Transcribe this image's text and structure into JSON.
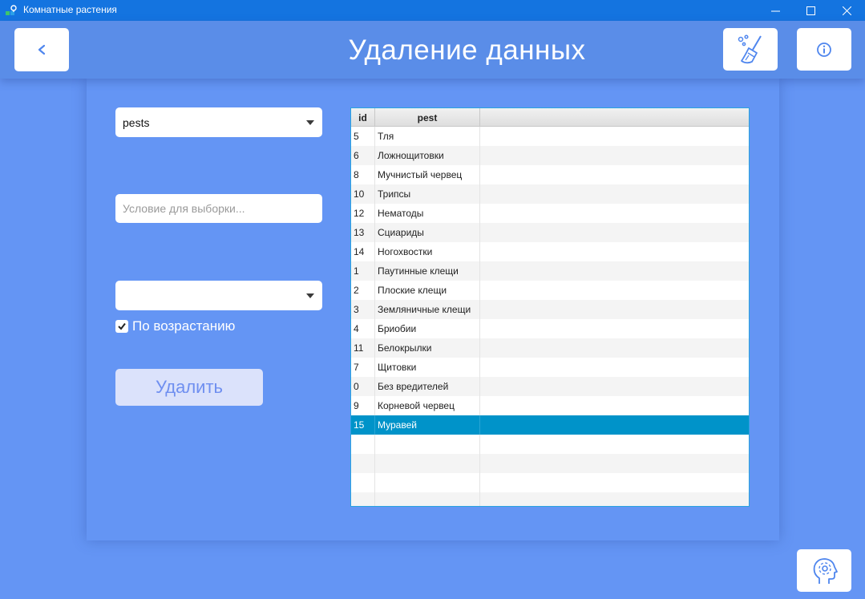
{
  "window": {
    "title": "Комнатные растения",
    "colors": {
      "titlebar": "#1474e0",
      "background": "#6495f4",
      "header": "#5a8de8",
      "selection": "#0093c9"
    }
  },
  "header": {
    "title": "Удаление данных",
    "icons": {
      "back": "chevron-left-icon",
      "clean": "broom-icon",
      "info": "info-icon",
      "settings": "head-gear-icon"
    }
  },
  "form": {
    "table_select_value": "pests",
    "condition_placeholder": "Условие для выборки...",
    "sort_select_value": "",
    "ascending_label": "По возрастанию",
    "ascending_checked": true,
    "delete_label": "Удалить"
  },
  "table": {
    "columns": [
      "id",
      "pest",
      ""
    ],
    "rows": [
      {
        "id": "5",
        "pest": "Тля"
      },
      {
        "id": "6",
        "pest": "Ложнощитовки"
      },
      {
        "id": "8",
        "pest": "Мучнистый червец"
      },
      {
        "id": "10",
        "pest": "Трипсы"
      },
      {
        "id": "12",
        "pest": "Нематоды"
      },
      {
        "id": "13",
        "pest": "Сциариды"
      },
      {
        "id": "14",
        "pest": "Ногохвостки"
      },
      {
        "id": "1",
        "pest": "Паутинные клещи"
      },
      {
        "id": "2",
        "pest": "Плоские клещи"
      },
      {
        "id": "3",
        "pest": "Земляничные клещи"
      },
      {
        "id": "4",
        "pest": "Бриобии"
      },
      {
        "id": "11",
        "pest": "Белокрылки"
      },
      {
        "id": "7",
        "pest": "Щитовки"
      },
      {
        "id": "0",
        "pest": "Без вредителей"
      },
      {
        "id": "9",
        "pest": "Корневой червец"
      },
      {
        "id": "15",
        "pest": "Муравей"
      }
    ],
    "selected_index": 15
  }
}
